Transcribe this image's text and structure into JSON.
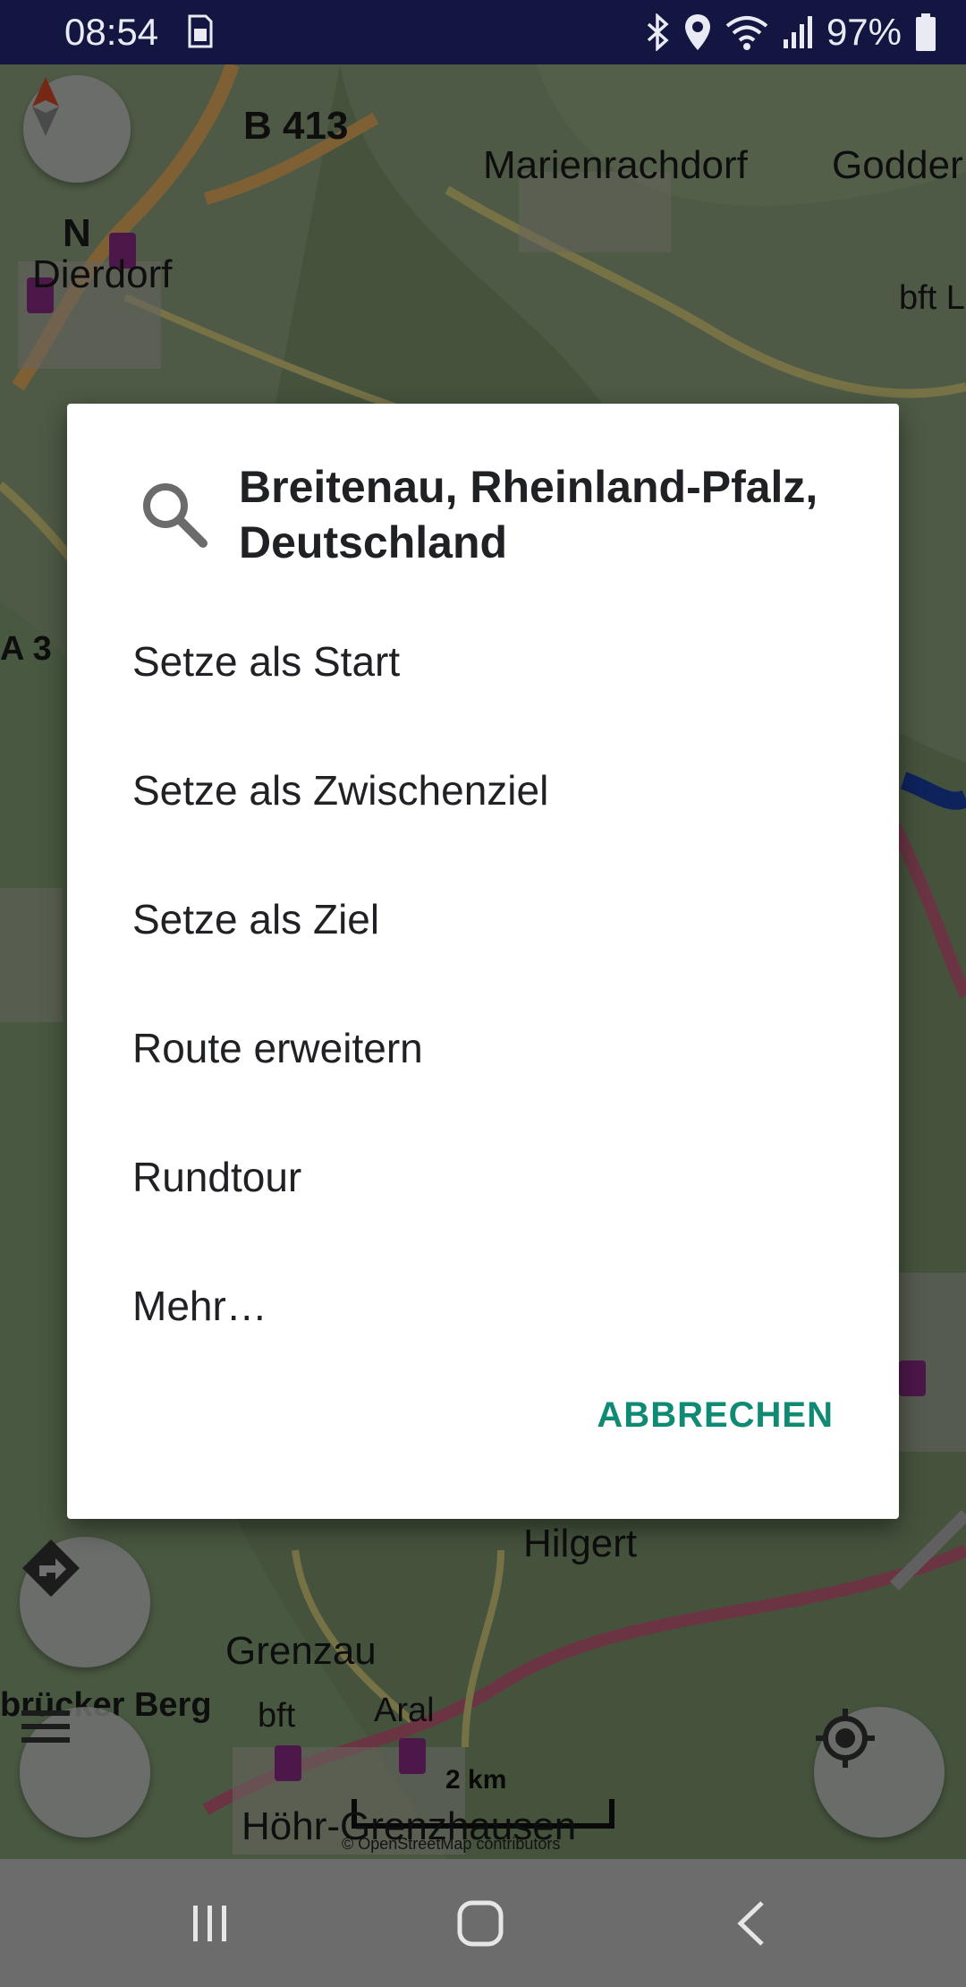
{
  "status_bar": {
    "time": "08:54",
    "battery": "97%"
  },
  "map": {
    "labels": {
      "b413": "B 413",
      "marienrachdorf": "Marienrachdorf",
      "godder": "Godder",
      "dierdorf": "Dierdorf",
      "north": "N",
      "bft1": "bft L",
      "a3": "A 3",
      "hilgert": "Hilgert",
      "grenzau": "Grenzau",
      "bruecker_berg": "brücker Berg",
      "bft2": "bft",
      "aral": "Aral",
      "hoehr": "Höhr-Grenzhausen"
    },
    "scale_label": "2 km",
    "attribution": "© OpenStreetMap contributors"
  },
  "dialog": {
    "title": "Breitenau, Rheinland-Pfalz, Deutschland",
    "items": [
      "Setze als Start",
      "Setze als Zwischenziel",
      "Setze als Ziel",
      "Route erweitern",
      "Rundtour",
      "Mehr…"
    ],
    "cancel_label": "ABBRECHEN",
    "accent": "#0f8a73"
  },
  "icons": {
    "search": "search-icon",
    "compass": "compass-icon",
    "directions": "directions-icon",
    "menu": "menu-icon",
    "locate": "my-location-icon"
  }
}
